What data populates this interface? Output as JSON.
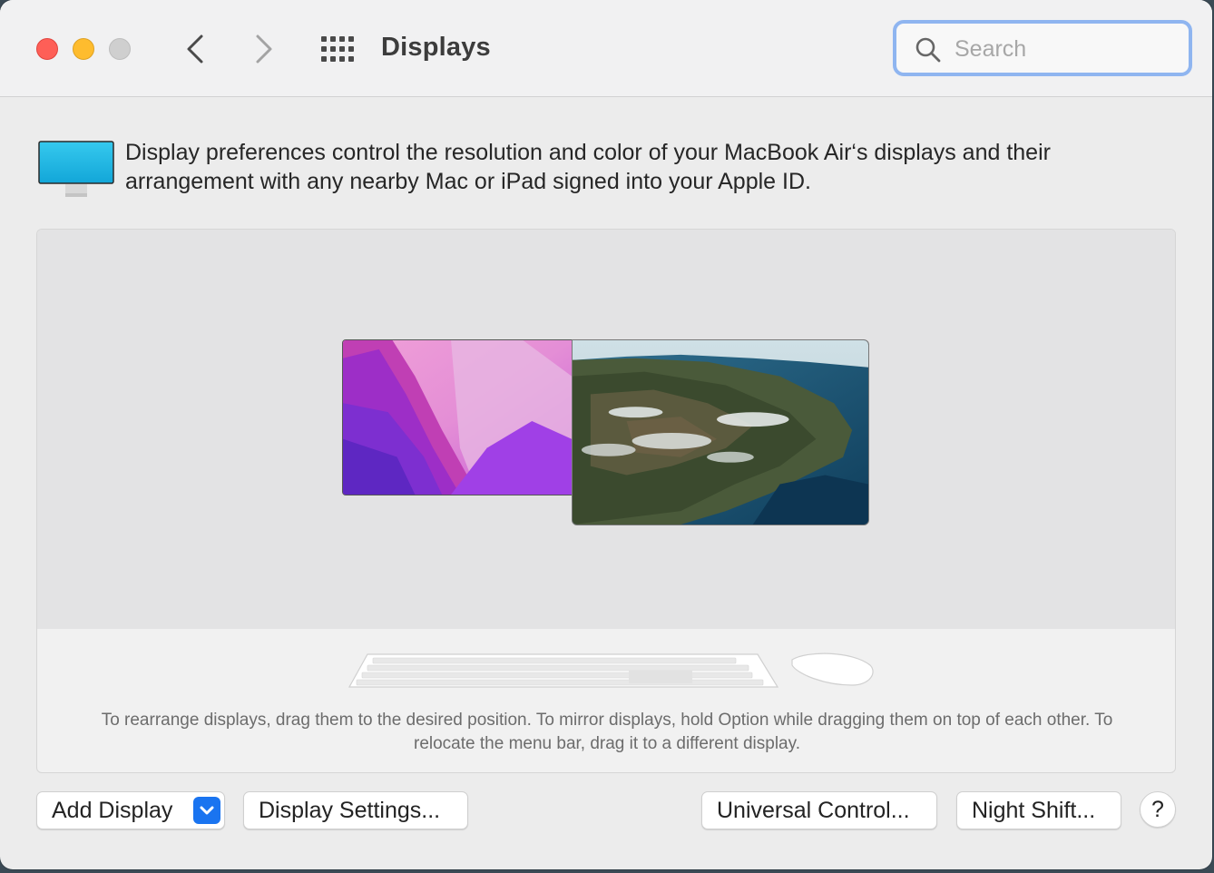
{
  "window": {
    "title": "Displays"
  },
  "search": {
    "placeholder": "Search",
    "value": ""
  },
  "intro": {
    "text": "Display preferences control the resolution and color of your MacBook Air‘s displays and their arrangement with any nearby Mac or iPad signed into your Apple ID."
  },
  "arrangement": {
    "displays": [
      "macbook-air-display",
      "ipad-display"
    ],
    "hint": "To rearrange displays, drag them to the desired position. To mirror displays, hold Option while dragging them on top of each other. To relocate the menu bar, drag it to a different display."
  },
  "buttons": {
    "add_display": "Add Display",
    "display_settings": "Display Settings...",
    "universal_control": "Universal Control...",
    "night_shift": "Night Shift...",
    "help": "?"
  },
  "icons": {
    "close": "close-icon",
    "minimize": "minimize-icon",
    "zoom": "zoom-icon",
    "back": "chevron-left-icon",
    "forward": "chevron-right-icon",
    "show_all": "grid-icon",
    "search": "search-icon",
    "display": "display-icon",
    "keyboard": "keyboard-icon",
    "mouse": "mouse-icon",
    "dropdown": "chevron-down-icon"
  },
  "colors": {
    "close": "#fe5f57",
    "minimize": "#febc2e",
    "zoom": "#cfcfcf",
    "accent": "#1a74f0",
    "search_focus": "#8fb5f0"
  }
}
